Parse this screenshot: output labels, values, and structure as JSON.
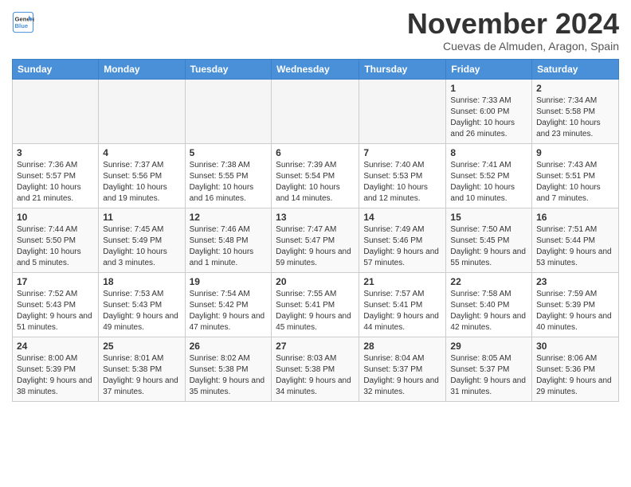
{
  "header": {
    "logo_line1": "General",
    "logo_line2": "Blue",
    "month": "November 2024",
    "location": "Cuevas de Almuden, Aragon, Spain"
  },
  "weekdays": [
    "Sunday",
    "Monday",
    "Tuesday",
    "Wednesday",
    "Thursday",
    "Friday",
    "Saturday"
  ],
  "weeks": [
    [
      {
        "day": "",
        "info": ""
      },
      {
        "day": "",
        "info": ""
      },
      {
        "day": "",
        "info": ""
      },
      {
        "day": "",
        "info": ""
      },
      {
        "day": "",
        "info": ""
      },
      {
        "day": "1",
        "info": "Sunrise: 7:33 AM\nSunset: 6:00 PM\nDaylight: 10 hours and 26 minutes."
      },
      {
        "day": "2",
        "info": "Sunrise: 7:34 AM\nSunset: 5:58 PM\nDaylight: 10 hours and 23 minutes."
      }
    ],
    [
      {
        "day": "3",
        "info": "Sunrise: 7:36 AM\nSunset: 5:57 PM\nDaylight: 10 hours and 21 minutes."
      },
      {
        "day": "4",
        "info": "Sunrise: 7:37 AM\nSunset: 5:56 PM\nDaylight: 10 hours and 19 minutes."
      },
      {
        "day": "5",
        "info": "Sunrise: 7:38 AM\nSunset: 5:55 PM\nDaylight: 10 hours and 16 minutes."
      },
      {
        "day": "6",
        "info": "Sunrise: 7:39 AM\nSunset: 5:54 PM\nDaylight: 10 hours and 14 minutes."
      },
      {
        "day": "7",
        "info": "Sunrise: 7:40 AM\nSunset: 5:53 PM\nDaylight: 10 hours and 12 minutes."
      },
      {
        "day": "8",
        "info": "Sunrise: 7:41 AM\nSunset: 5:52 PM\nDaylight: 10 hours and 10 minutes."
      },
      {
        "day": "9",
        "info": "Sunrise: 7:43 AM\nSunset: 5:51 PM\nDaylight: 10 hours and 7 minutes."
      }
    ],
    [
      {
        "day": "10",
        "info": "Sunrise: 7:44 AM\nSunset: 5:50 PM\nDaylight: 10 hours and 5 minutes."
      },
      {
        "day": "11",
        "info": "Sunrise: 7:45 AM\nSunset: 5:49 PM\nDaylight: 10 hours and 3 minutes."
      },
      {
        "day": "12",
        "info": "Sunrise: 7:46 AM\nSunset: 5:48 PM\nDaylight: 10 hours and 1 minute."
      },
      {
        "day": "13",
        "info": "Sunrise: 7:47 AM\nSunset: 5:47 PM\nDaylight: 9 hours and 59 minutes."
      },
      {
        "day": "14",
        "info": "Sunrise: 7:49 AM\nSunset: 5:46 PM\nDaylight: 9 hours and 57 minutes."
      },
      {
        "day": "15",
        "info": "Sunrise: 7:50 AM\nSunset: 5:45 PM\nDaylight: 9 hours and 55 minutes."
      },
      {
        "day": "16",
        "info": "Sunrise: 7:51 AM\nSunset: 5:44 PM\nDaylight: 9 hours and 53 minutes."
      }
    ],
    [
      {
        "day": "17",
        "info": "Sunrise: 7:52 AM\nSunset: 5:43 PM\nDaylight: 9 hours and 51 minutes."
      },
      {
        "day": "18",
        "info": "Sunrise: 7:53 AM\nSunset: 5:43 PM\nDaylight: 9 hours and 49 minutes."
      },
      {
        "day": "19",
        "info": "Sunrise: 7:54 AM\nSunset: 5:42 PM\nDaylight: 9 hours and 47 minutes."
      },
      {
        "day": "20",
        "info": "Sunrise: 7:55 AM\nSunset: 5:41 PM\nDaylight: 9 hours and 45 minutes."
      },
      {
        "day": "21",
        "info": "Sunrise: 7:57 AM\nSunset: 5:41 PM\nDaylight: 9 hours and 44 minutes."
      },
      {
        "day": "22",
        "info": "Sunrise: 7:58 AM\nSunset: 5:40 PM\nDaylight: 9 hours and 42 minutes."
      },
      {
        "day": "23",
        "info": "Sunrise: 7:59 AM\nSunset: 5:39 PM\nDaylight: 9 hours and 40 minutes."
      }
    ],
    [
      {
        "day": "24",
        "info": "Sunrise: 8:00 AM\nSunset: 5:39 PM\nDaylight: 9 hours and 38 minutes."
      },
      {
        "day": "25",
        "info": "Sunrise: 8:01 AM\nSunset: 5:38 PM\nDaylight: 9 hours and 37 minutes."
      },
      {
        "day": "26",
        "info": "Sunrise: 8:02 AM\nSunset: 5:38 PM\nDaylight: 9 hours and 35 minutes."
      },
      {
        "day": "27",
        "info": "Sunrise: 8:03 AM\nSunset: 5:38 PM\nDaylight: 9 hours and 34 minutes."
      },
      {
        "day": "28",
        "info": "Sunrise: 8:04 AM\nSunset: 5:37 PM\nDaylight: 9 hours and 32 minutes."
      },
      {
        "day": "29",
        "info": "Sunrise: 8:05 AM\nSunset: 5:37 PM\nDaylight: 9 hours and 31 minutes."
      },
      {
        "day": "30",
        "info": "Sunrise: 8:06 AM\nSunset: 5:36 PM\nDaylight: 9 hours and 29 minutes."
      }
    ]
  ]
}
